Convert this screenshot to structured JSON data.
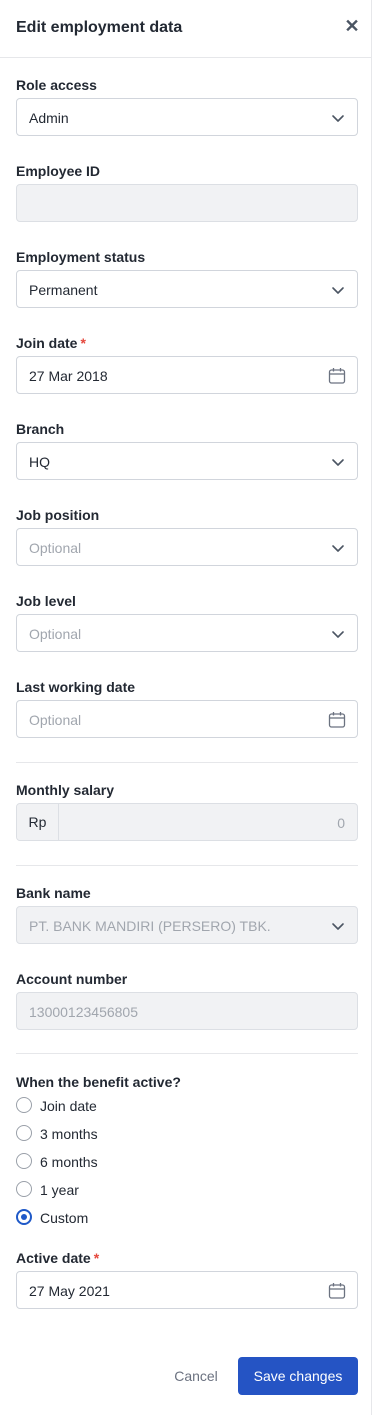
{
  "header": {
    "title": "Edit employment data",
    "close_icon": "close-icon"
  },
  "form": {
    "role_access": {
      "label": "Role access",
      "value": "Admin"
    },
    "employee_id": {
      "label": "Employee ID",
      "value": ""
    },
    "employment_status": {
      "label": "Employment status",
      "value": "Permanent"
    },
    "join_date": {
      "label": "Join date",
      "required_mark": "*",
      "value": "27 Mar 2018"
    },
    "branch": {
      "label": "Branch",
      "value": "HQ"
    },
    "job_position": {
      "label": "Job position",
      "placeholder": "Optional"
    },
    "job_level": {
      "label": "Job level",
      "placeholder": "Optional"
    },
    "last_working_date": {
      "label": "Last working date",
      "placeholder": "Optional"
    },
    "monthly_salary": {
      "label": "Monthly salary",
      "prefix": "Rp",
      "value": "0"
    },
    "bank_name": {
      "label": "Bank name",
      "value": "PT. BANK MANDIRI (PERSERO) TBK."
    },
    "account_number": {
      "label": "Account number",
      "value": "13000123456805"
    },
    "benefit": {
      "label": "When the benefit active?",
      "options": [
        "Join date",
        "3 months",
        "6 months",
        "1 year",
        "Custom"
      ],
      "selected": "Custom"
    },
    "active_date": {
      "label": "Active date",
      "required_mark": "*",
      "value": "27 May 2021"
    }
  },
  "footer": {
    "cancel_label": "Cancel",
    "save_label": "Save changes"
  },
  "colors": {
    "primary": "#2554c4",
    "required": "#e5483d",
    "disabled_bg": "#f1f2f4"
  }
}
